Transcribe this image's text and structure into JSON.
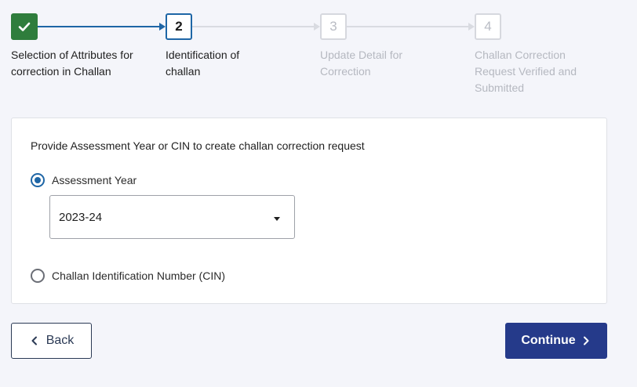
{
  "stepper": {
    "steps": [
      {
        "number": "",
        "label": "Selection of Attributes for correction in Challan",
        "status": "completed"
      },
      {
        "number": "2",
        "label": "Identification of challan",
        "status": "active"
      },
      {
        "number": "3",
        "label": "Update Detail for Correction",
        "status": "pending"
      },
      {
        "number": "4",
        "label": "Challan Correction Request Verified and Submitted",
        "status": "pending"
      }
    ]
  },
  "form": {
    "prompt": "Provide Assessment Year or CIN to create challan correction request",
    "options": [
      {
        "label": "Assessment Year",
        "selected": true
      },
      {
        "label": "Challan Identification Number (CIN)",
        "selected": false
      }
    ],
    "assessment_year": {
      "value": "2023-24"
    }
  },
  "actions": {
    "back_label": "Back",
    "continue_label": "Continue"
  },
  "colors": {
    "completed": "#2f7d3c",
    "active": "#1e66a6",
    "pending": "#d6d8de",
    "primary_button": "#253a8a"
  }
}
